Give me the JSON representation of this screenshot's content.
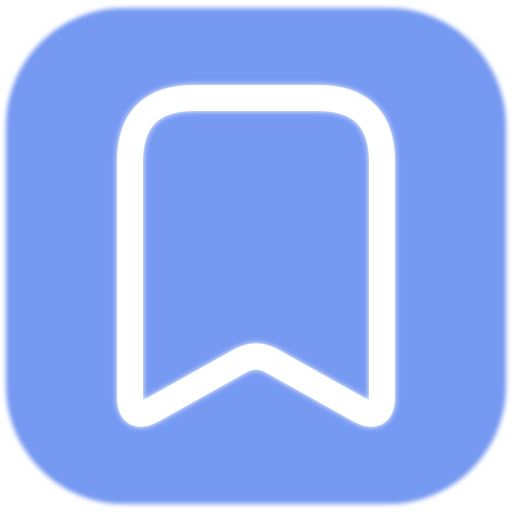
{
  "icon": {
    "name": "bookmark-minus-icon",
    "background_color": "#7699F2",
    "glyph_color": "#FFFFFF"
  }
}
